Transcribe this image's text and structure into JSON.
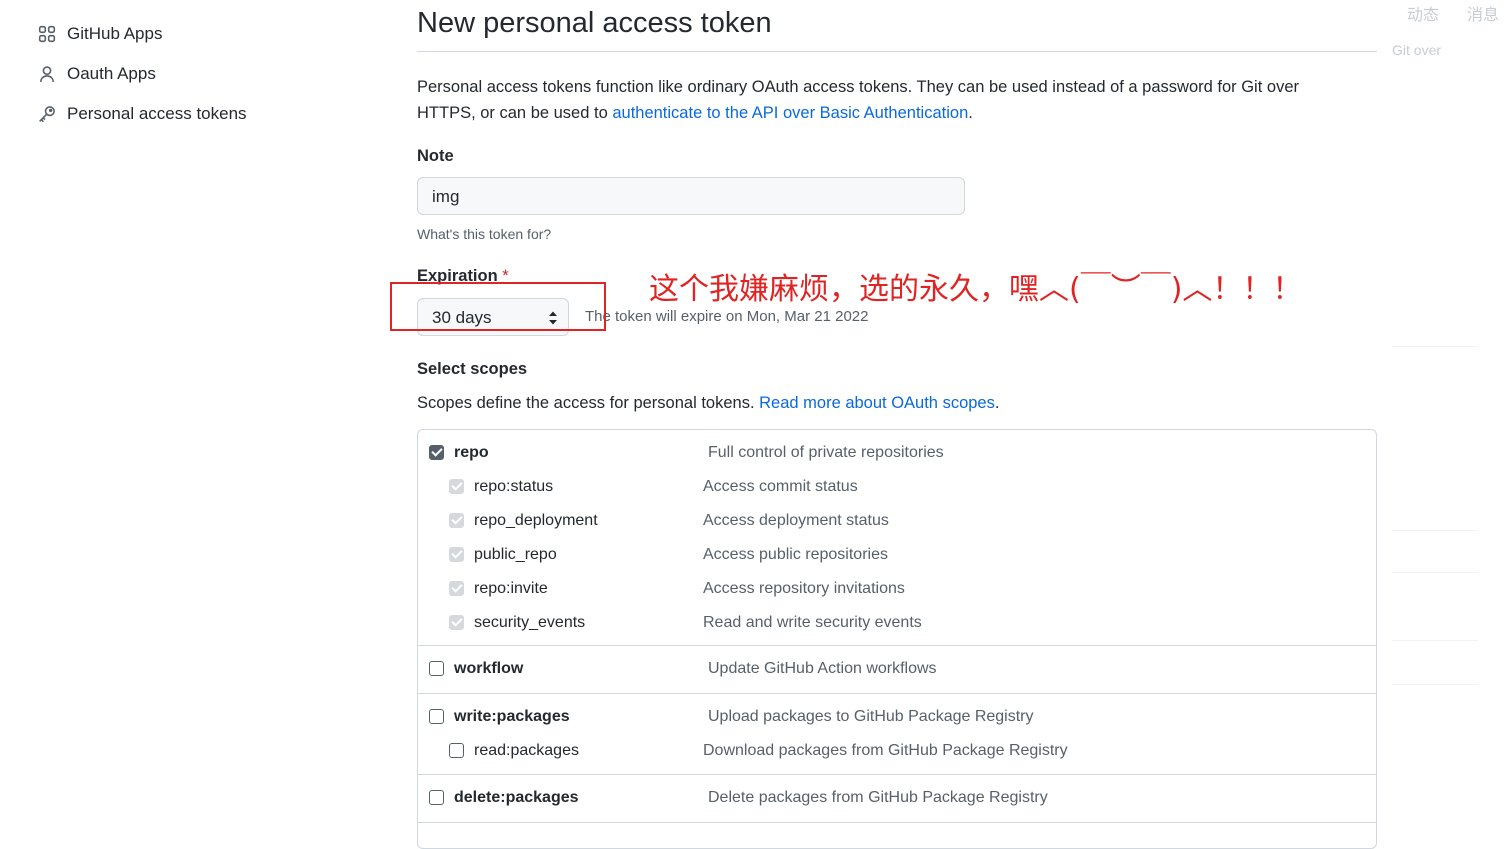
{
  "sidebar": {
    "items": [
      {
        "label": "GitHub Apps",
        "icon": "apps-grid-icon"
      },
      {
        "label": "Oauth Apps",
        "icon": "person-icon"
      },
      {
        "label": "Personal access tokens",
        "icon": "key-icon"
      }
    ]
  },
  "page": {
    "title": "New personal access token",
    "intro_text": "Personal access tokens function like ordinary OAuth access tokens. They can be used instead of a password for Git over HTTPS, or can be used to ",
    "intro_link": "authenticate to the API over Basic Authentication",
    "intro_end": "."
  },
  "note": {
    "label": "Note",
    "value": "img",
    "hint": "What's this token for?"
  },
  "expiration": {
    "label": "Expiration",
    "required_mark": "*",
    "selected": "30 days",
    "note": "The token will expire on Mon, Mar 21 2022"
  },
  "scopes": {
    "label": "Select scopes",
    "desc": "Scopes define the access for personal tokens. ",
    "link": "Read more about OAuth scopes",
    "link_end": ".",
    "groups": [
      {
        "parent": {
          "name": "repo",
          "desc": "Full control of private repositories",
          "checked": true
        },
        "children": [
          {
            "name": "repo:status",
            "desc": "Access commit status"
          },
          {
            "name": "repo_deployment",
            "desc": "Access deployment status"
          },
          {
            "name": "public_repo",
            "desc": "Access public repositories"
          },
          {
            "name": "repo:invite",
            "desc": "Access repository invitations"
          },
          {
            "name": "security_events",
            "desc": "Read and write security events"
          }
        ]
      },
      {
        "parent": {
          "name": "workflow",
          "desc": "Update GitHub Action workflows",
          "checked": false
        },
        "children": []
      },
      {
        "parent": {
          "name": "write:packages",
          "desc": "Upload packages to GitHub Package Registry",
          "checked": false
        },
        "children": [
          {
            "name": "read:packages",
            "desc": "Download packages from GitHub Package Registry",
            "checked": false
          }
        ]
      },
      {
        "parent": {
          "name": "delete:packages",
          "desc": "Delete packages from GitHub Package Registry",
          "checked": false
        },
        "children": []
      }
    ]
  },
  "annotation": {
    "text": "这个我嫌麻烦，选的永久，嘿︿(￣︶￣)︿！！！",
    "color": "#e02424"
  },
  "faded_right": {
    "top_links": [
      "动态",
      "消息"
    ],
    "fragment": "Git over"
  }
}
